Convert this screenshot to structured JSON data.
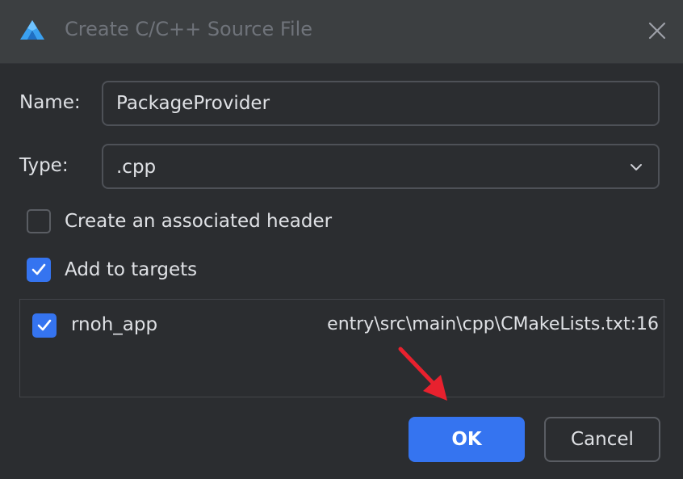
{
  "window": {
    "title": "Create C/C++ Source File",
    "logo_icon": "app-logo-icon",
    "close_icon": "close-icon"
  },
  "form": {
    "name_label": "Name:",
    "name_value": "PackageProvider",
    "type_label": "Type:",
    "type_value": ".cpp",
    "type_dropdown_icon": "chevron-down-icon"
  },
  "options": {
    "associated_header": {
      "label": "Create an associated header",
      "checked": false
    },
    "add_to_targets": {
      "label": "Add to targets",
      "checked": true
    }
  },
  "targets": [
    {
      "name": "rnoh_app",
      "path": "entry\\src\\main\\cpp\\CMakeLists.txt:16",
      "checked": true
    }
  ],
  "buttons": {
    "ok_label": "OK",
    "cancel_label": "Cancel"
  },
  "annotation": {
    "arrow_color": "#e8212e",
    "arrow_icon": "red-arrow-icon"
  },
  "colors": {
    "accent": "#3574f0",
    "background": "#2b2d30",
    "titlebar": "#3c3f41"
  }
}
